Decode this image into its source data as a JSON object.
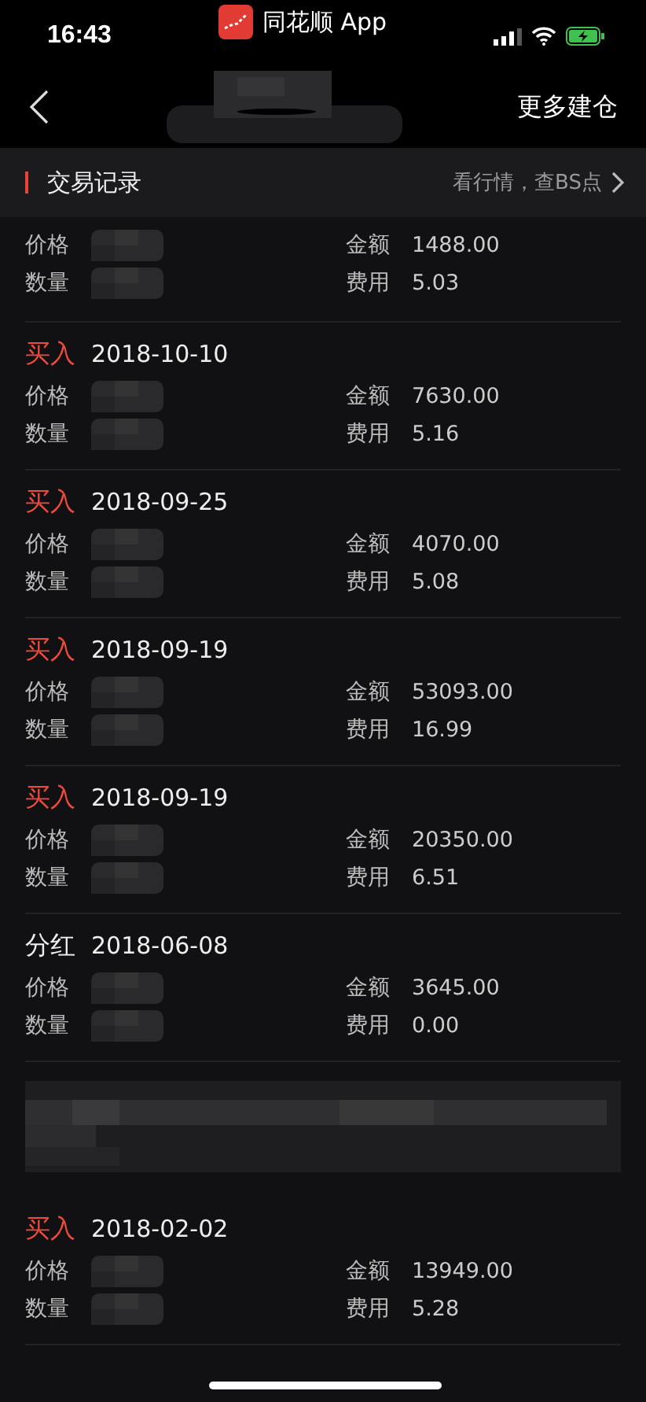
{
  "status_bar": {
    "time": "16:43",
    "app": "同花顺 App"
  },
  "nav": {
    "action": "更多建仓"
  },
  "section": {
    "title": "交易记录",
    "link": "看行情，查BS点"
  },
  "records": [
    {
      "kind": "partial",
      "amount_label": "金额",
      "amount": "1488.00",
      "price_label": "价格",
      "qty_label": "数量",
      "fee_label": "费用",
      "fee": "5.03"
    },
    {
      "kind": "buy",
      "type": "买入",
      "date": "2018-10-10",
      "price_label": "价格",
      "amount_label": "金额",
      "amount": "7630.00",
      "qty_label": "数量",
      "fee_label": "费用",
      "fee": "5.16"
    },
    {
      "kind": "buy",
      "type": "买入",
      "date": "2018-09-25",
      "price_label": "价格",
      "amount_label": "金额",
      "amount": "4070.00",
      "qty_label": "数量",
      "fee_label": "费用",
      "fee": "5.08"
    },
    {
      "kind": "buy",
      "type": "买入",
      "date": "2018-09-19",
      "price_label": "价格",
      "amount_label": "金额",
      "amount": "53093.00",
      "qty_label": "数量",
      "fee_label": "费用",
      "fee": "16.99"
    },
    {
      "kind": "buy",
      "type": "买入",
      "date": "2018-09-19",
      "price_label": "价格",
      "amount_label": "金额",
      "amount": "20350.00",
      "qty_label": "数量",
      "fee_label": "费用",
      "fee": "6.51"
    },
    {
      "kind": "dividend",
      "type": "分红",
      "date": "2018-06-08",
      "price_label": "价格",
      "amount_label": "金额",
      "amount": "3645.00",
      "qty_label": "数量",
      "fee_label": "费用",
      "fee": "0.00"
    },
    {
      "kind": "redacted"
    },
    {
      "kind": "buy",
      "type": "买入",
      "date": "2018-02-02",
      "price_label": "价格",
      "amount_label": "金额",
      "amount": "13949.00",
      "qty_label": "数量",
      "fee_label": "费用",
      "fee": "5.28"
    }
  ]
}
